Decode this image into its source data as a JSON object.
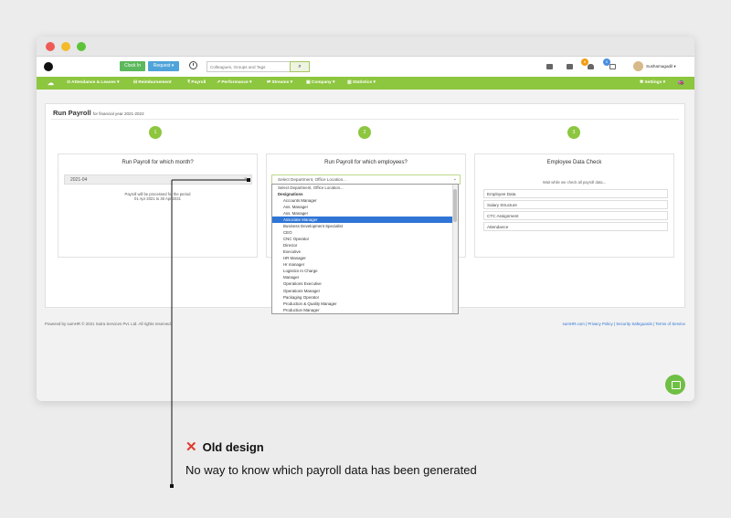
{
  "topbar": {
    "clock_in": "Clock In",
    "request": "Request ▾",
    "search_placeholder": "Colleagues, Groups and Tags",
    "badge1": "8",
    "badge2": "0",
    "user": "Sushamagadil ▾"
  },
  "nav": {
    "attendance": "⊙ Attendance & Leaves ▾",
    "reimbursement": "⊟ Reimbursement",
    "payroll": "₹ Payroll",
    "performance": "↗ Performance ▾",
    "streams": "⇄ Streams ▾",
    "company": "▣ Company ▾",
    "statistics": "▥ Statistics ▾",
    "settings": "✱ Settings ▾",
    "flag": "🇬🇧"
  },
  "page": {
    "title": "Run Payroll",
    "subtitle": "for financial year 2021-2022"
  },
  "steps": [
    "1",
    "2",
    "3"
  ],
  "panel1": {
    "heading": "Run Payroll for which month?",
    "month_value": "2021-04",
    "month_clear": "×",
    "note_line1": "Payroll will be processed for the period",
    "note_line2": "01 Apr 2021 to 30 Apr 2021"
  },
  "panel2": {
    "heading": "Run Payroll for which employees?",
    "placeholder": "Select Department, Office Location...",
    "caret": "⌄"
  },
  "panel3": {
    "heading": "Employee Data Check",
    "wait": "Wait while we check all payroll data...",
    "checks": [
      "Employee Data",
      "Salary Structure",
      "CTC Assignment",
      "Attendance"
    ]
  },
  "dropdown": {
    "first": "Select Department, Office Location...",
    "group": "Designations",
    "options": [
      "Accounts Manager",
      "Ass. Manager",
      "Ass. Manager",
      "Associate Manager",
      "Business Development Specialist",
      "CEO",
      "CNC Operator",
      "Director",
      "Executive",
      "HR Manager",
      "Hr manager",
      "Logistics In Charge",
      "Manager",
      "Operations Executive",
      "Operations Manager",
      "Packaging Operator",
      "Production & Quality Manager",
      "Production Manager"
    ],
    "selected_index": 3
  },
  "footer": {
    "left": "Powered by sumHR © 2021 Sutra Services Pvt. Ltd. All rights reserved.",
    "links": "sumHR.com  |  Privacy Policy  |  Security Safeguards  |  Terms of Service"
  },
  "annotation": {
    "mark": "✕",
    "title": "Old design",
    "text": "No way to know which payroll data has been generated"
  }
}
